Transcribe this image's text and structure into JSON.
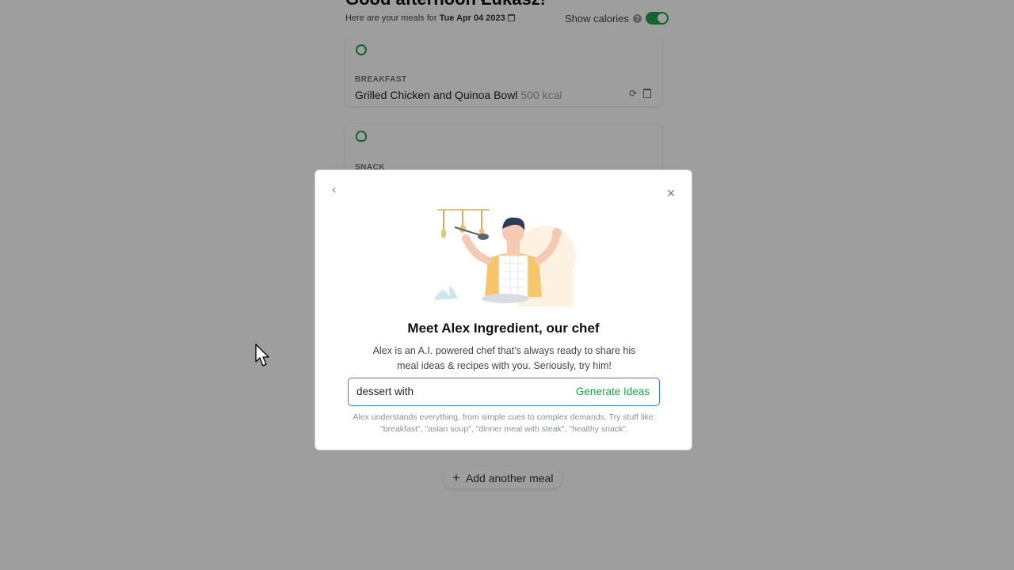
{
  "header": {
    "greeting": "Good afternoon Łukasz!",
    "subline_prefix": "Here are your meals for",
    "date": "Tue Apr 04 2023",
    "show_calories_label": "Show calories",
    "help_glyph": "?",
    "show_calories_on": true
  },
  "meals": [
    {
      "type": "BREAKFAST",
      "name": "Grilled Chicken and Quinoa Bowl",
      "kcal": "500 kcal",
      "icon": "breakfast-icon"
    },
    {
      "type": "SNACK",
      "icon": "snack-icon"
    }
  ],
  "add_meal": {
    "label": "Add another meal",
    "icon": "plus-icon"
  },
  "modal": {
    "title": "Meet Alex Ingredient, our chef",
    "description": "Alex is an A.I. powered chef that's always ready to share his meal ideas & recipes with you. Seriously, try him!",
    "input_value": "dessert with",
    "generate_label": "Generate Ideas",
    "hint": "Alex understands everything, from simple cues to complex demands. Try stuff like: \"breakfast\", \"asian soup\", \"dinner meal with steak\", \"healthy snack\".",
    "close_glyph": "×",
    "back_glyph": "‹"
  },
  "colors": {
    "accent_green": "#1fa34a",
    "focus_blue": "#3b7ddd",
    "overlay": "rgba(0,0,0,0.38)"
  }
}
